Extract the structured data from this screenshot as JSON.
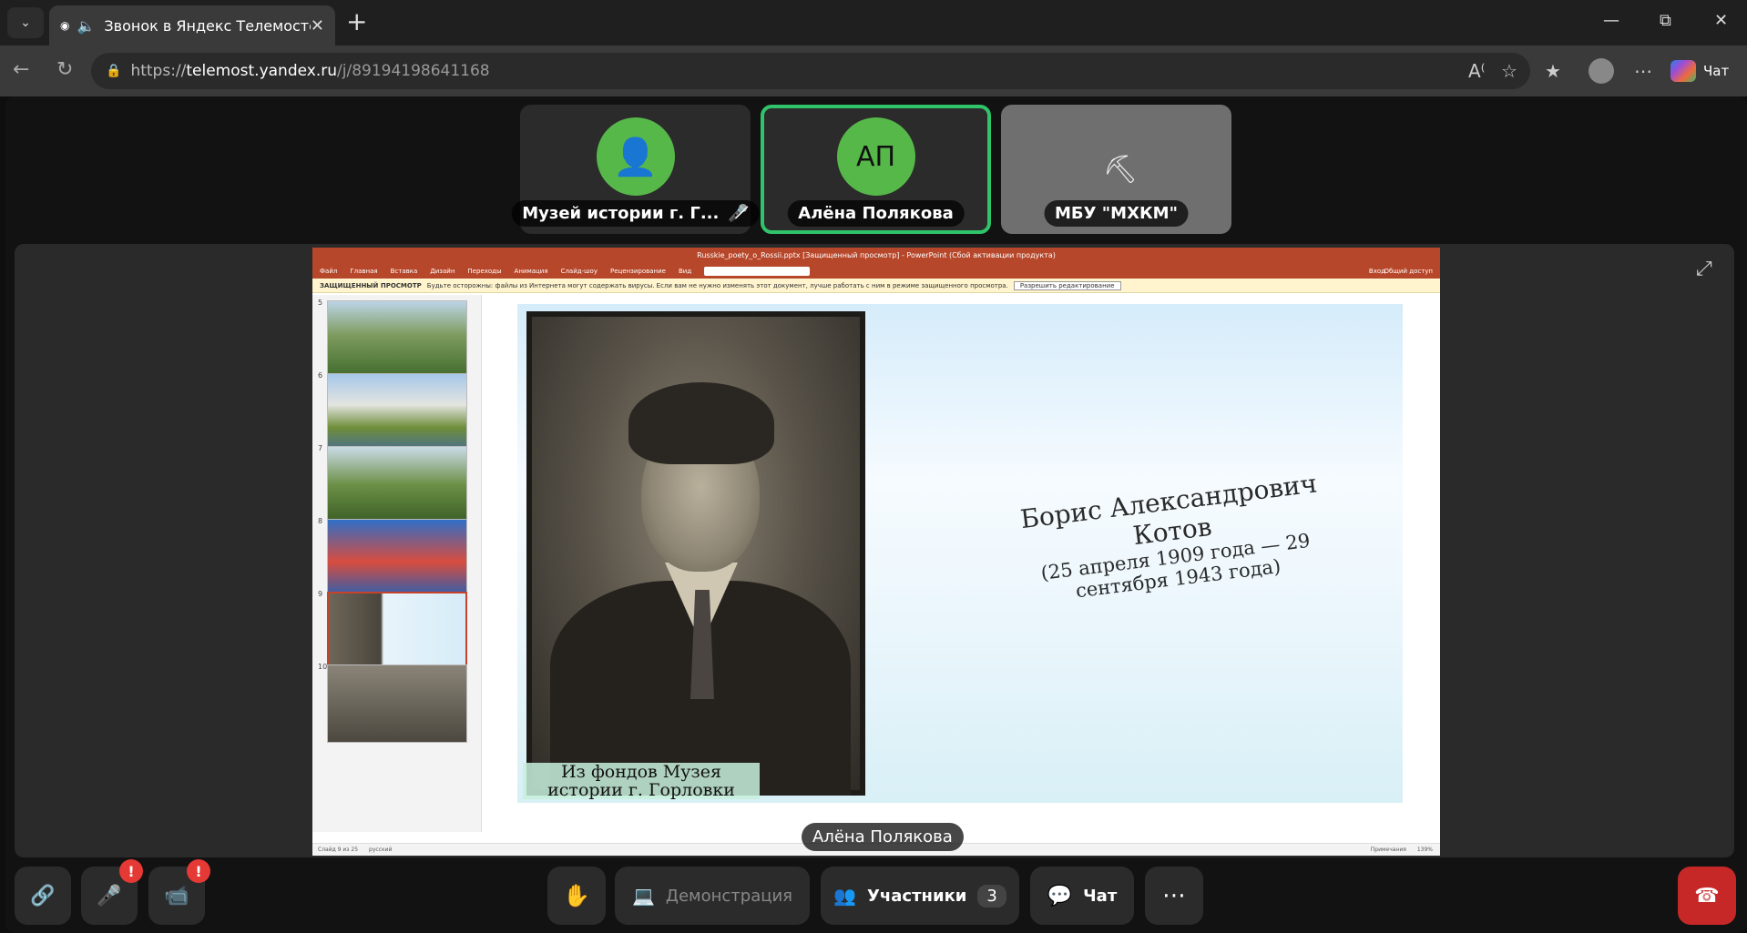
{
  "browser": {
    "tab_title": "Звонок в Яндекс Телемосте",
    "url_scheme": "https://",
    "url_host": "telemost.yandex.ru",
    "url_path": "/j/89194198641168",
    "chat_label": "Чат"
  },
  "participants": {
    "tiles": [
      {
        "name": "Музей истории г. Г...",
        "avatar_initials": "",
        "muted": true
      },
      {
        "name": "Алёна Полякова",
        "avatar_initials": "АП",
        "speaking": true
      },
      {
        "name": "МБУ \"МХКМ\""
      }
    ]
  },
  "screen_share": {
    "window_title": "Russkie_poety_o_Rossii.pptx [Защищенный просмотр] - PowerPoint (Сбой активации продукта)",
    "ribbon_tabs": [
      "Файл",
      "Главная",
      "Вставка",
      "Дизайн",
      "Переходы",
      "Анимация",
      "Слайд-шоу",
      "Рецензирование",
      "Вид"
    ],
    "ribbon_right": [
      "Вход",
      "Общий доступ"
    ],
    "protected_label": "ЗАЩИЩЕННЫЙ ПРОСМОТР",
    "protected_text": "Будьте осторожны: файлы из Интернета могут содержать вирусы. Если вам не нужно изменять этот документ, лучше работать с ним в режиме защищенного просмотра.",
    "protected_button": "Разрешить редактирование",
    "thumbnail_numbers": [
      "5",
      "6",
      "7",
      "8",
      "9",
      "10"
    ],
    "slide": {
      "name": "Борис Александрович Котов",
      "dates": "(25 апреля 1909 года — 29 сентября 1943 года)",
      "caption": "Из фондов Музея истории г. Горловки"
    },
    "status_left": "Слайд 9 из 25",
    "status_lang": "русский",
    "status_notes": "Примечания",
    "status_zoom": "139%"
  },
  "call": {
    "active_speaker": "Алёна Полякова",
    "controls": {
      "demo": "Демонстрация",
      "participants": "Участники",
      "participants_count": "3",
      "chat": "Чат",
      "badge": "!"
    }
  },
  "colors": {
    "speaking_border": "#2fc36a",
    "avatar_green": "#57b84a",
    "ppt_red": "#b7472a",
    "hangup_red": "#c62828"
  }
}
